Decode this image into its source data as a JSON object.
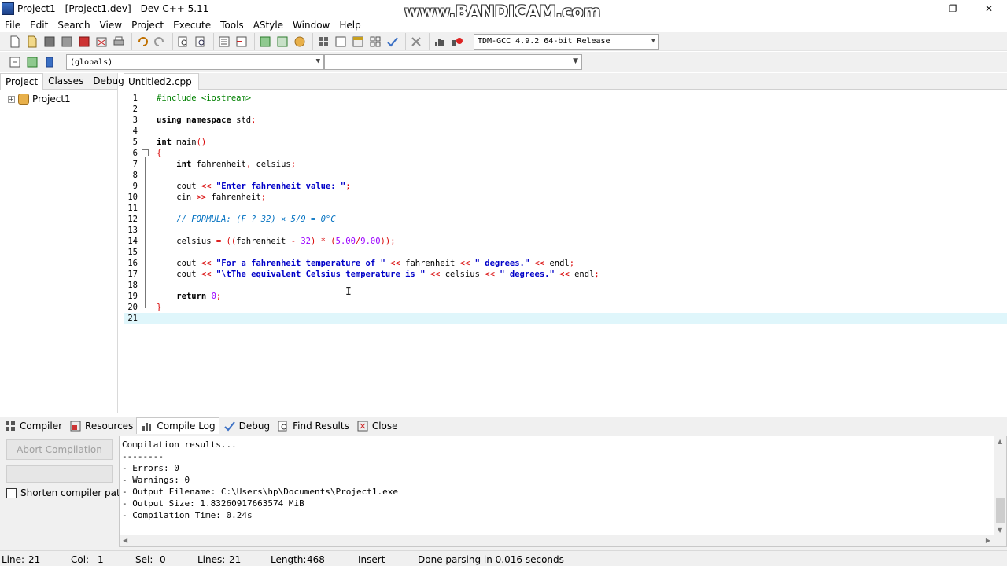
{
  "window": {
    "title": "Project1 - [Project1.dev] - Dev-C++ 5.11",
    "watermark": "www.BANDICAM.com",
    "minimize": "—",
    "restore": "❐",
    "close": "✕"
  },
  "menu": [
    "File",
    "Edit",
    "Search",
    "View",
    "Project",
    "Execute",
    "Tools",
    "AStyle",
    "Window",
    "Help"
  ],
  "toolbar": {
    "compiler": "TDM-GCC 4.9.2 64-bit Release",
    "scope": "(globals)"
  },
  "left_panel": {
    "tabs": [
      "Project",
      "Classes",
      "Debug"
    ],
    "tree_item": "Project1"
  },
  "editor": {
    "tab": "Untitled2.cpp",
    "lines": [
      [
        {
          "t": "#include <iostream>",
          "c": "pp"
        }
      ],
      [],
      [
        {
          "t": "using namespace ",
          "c": "kw"
        },
        {
          "t": "std",
          "c": "id"
        },
        {
          "t": ";",
          "c": "sym"
        }
      ],
      [],
      [
        {
          "t": "int ",
          "c": "kw"
        },
        {
          "t": "main",
          "c": "id"
        },
        {
          "t": "()",
          "c": "sym"
        }
      ],
      [
        {
          "t": "{",
          "c": "sym"
        }
      ],
      [
        {
          "t": "    ",
          "c": "id"
        },
        {
          "t": "int ",
          "c": "kw"
        },
        {
          "t": "fahrenheit",
          "c": "id"
        },
        {
          "t": ", ",
          "c": "sym"
        },
        {
          "t": "celsius",
          "c": "id"
        },
        {
          "t": ";",
          "c": "sym"
        }
      ],
      [],
      [
        {
          "t": "    cout ",
          "c": "id"
        },
        {
          "t": "<<",
          "c": "op"
        },
        {
          "t": " \"Enter fahrenheit value: \"",
          "c": "str"
        },
        {
          "t": ";",
          "c": "sym"
        }
      ],
      [
        {
          "t": "    cin ",
          "c": "id"
        },
        {
          "t": ">>",
          "c": "op"
        },
        {
          "t": " fahrenheit",
          "c": "id"
        },
        {
          "t": ";",
          "c": "sym"
        }
      ],
      [],
      [
        {
          "t": "    // FORMULA: (F ? 32) × 5/9 = 0°C",
          "c": "cm"
        }
      ],
      [],
      [
        {
          "t": "    celsius ",
          "c": "id"
        },
        {
          "t": "= ((",
          "c": "sym"
        },
        {
          "t": "fahrenheit ",
          "c": "id"
        },
        {
          "t": "- ",
          "c": "sym"
        },
        {
          "t": "32",
          "c": "num"
        },
        {
          "t": ") * (",
          "c": "sym"
        },
        {
          "t": "5.00",
          "c": "num"
        },
        {
          "t": "/",
          "c": "sym"
        },
        {
          "t": "9.00",
          "c": "num"
        },
        {
          "t": "));",
          "c": "sym"
        }
      ],
      [],
      [
        {
          "t": "    cout ",
          "c": "id"
        },
        {
          "t": "<<",
          "c": "op"
        },
        {
          "t": " \"For a fahrenheit temperature of \" ",
          "c": "str"
        },
        {
          "t": "<<",
          "c": "op"
        },
        {
          "t": " fahrenheit ",
          "c": "id"
        },
        {
          "t": "<<",
          "c": "op"
        },
        {
          "t": " \" degrees.\" ",
          "c": "str"
        },
        {
          "t": "<<",
          "c": "op"
        },
        {
          "t": " endl",
          "c": "id"
        },
        {
          "t": ";",
          "c": "sym"
        }
      ],
      [
        {
          "t": "    cout ",
          "c": "id"
        },
        {
          "t": "<<",
          "c": "op"
        },
        {
          "t": " \"\\tThe equivalent Celsius temperature is \" ",
          "c": "str"
        },
        {
          "t": "<<",
          "c": "op"
        },
        {
          "t": " celsius ",
          "c": "id"
        },
        {
          "t": "<<",
          "c": "op"
        },
        {
          "t": " \" degrees.\" ",
          "c": "str"
        },
        {
          "t": "<<",
          "c": "op"
        },
        {
          "t": " endl",
          "c": "id"
        },
        {
          "t": ";",
          "c": "sym"
        }
      ],
      [],
      [
        {
          "t": "    ",
          "c": "id"
        },
        {
          "t": "return ",
          "c": "kw"
        },
        {
          "t": "0",
          "c": "num"
        },
        {
          "t": ";",
          "c": "sym"
        }
      ],
      [
        {
          "t": "}",
          "c": "sym"
        }
      ],
      []
    ],
    "current_line": 21
  },
  "bottom_tabs": [
    "Compiler",
    "Resources",
    "Compile Log",
    "Debug",
    "Find Results",
    "Close"
  ],
  "bottom": {
    "abort_label": "Abort Compilation",
    "shorten_label": "Shorten compiler paths",
    "log": [
      "Compilation results...",
      "--------",
      "- Errors: 0",
      "- Warnings: 0",
      "- Output Filename: C:\\Users\\hp\\Documents\\Project1.exe",
      "- Output Size: 1.83260917663574 MiB",
      "- Compilation Time: 0.24s"
    ]
  },
  "status": {
    "line_label": "Line:",
    "line_value": "21",
    "col_label": "Col:",
    "col_value": "1",
    "sel_label": "Sel:",
    "sel_value": "0",
    "lines_label": "Lines:",
    "lines_value": "21",
    "length_label": "Length:",
    "length_value": "468",
    "mode": "Insert",
    "message": "Done parsing in 0.016 seconds"
  }
}
